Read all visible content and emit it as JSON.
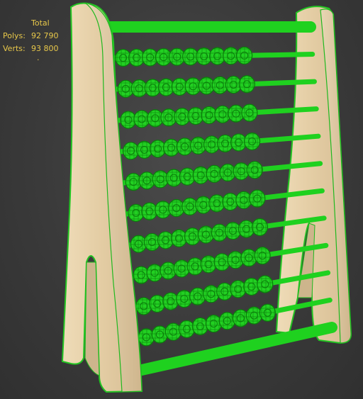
{
  "viewport": {
    "mode": "perspective",
    "display": "wireframe-on-shaded"
  },
  "stats": {
    "header": "Total",
    "polys_label": "Polys:",
    "polys_value": "92 790",
    "verts_label": "Verts:",
    "verts_value": "93 800",
    "marker": "."
  },
  "model": {
    "name": "abacus",
    "rod_count": 12,
    "beads_per_rod": 10,
    "colors": {
      "wood": "#e6d2ae",
      "wood_shade": "#cdb58c",
      "selection_green": "#1fd11f",
      "bead_wire": "#0a7d0a"
    }
  }
}
